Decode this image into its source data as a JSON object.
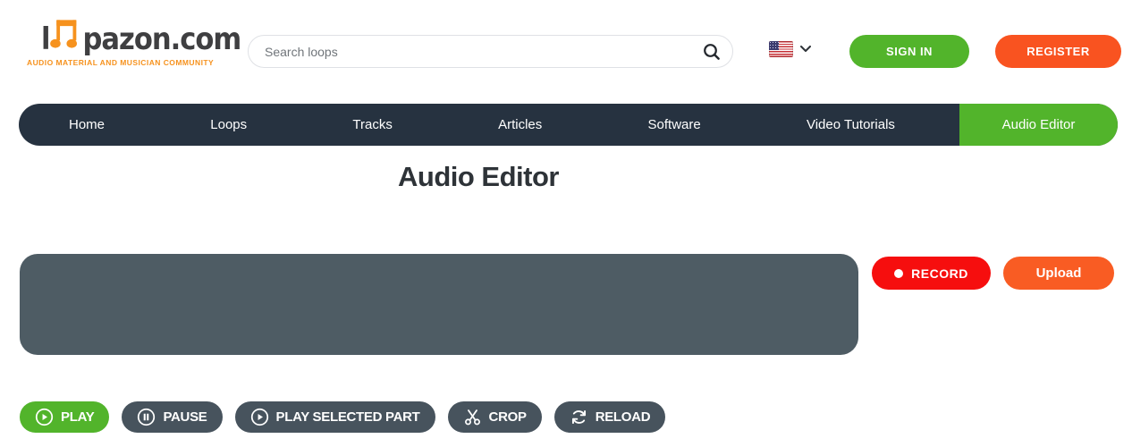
{
  "colors": {
    "accent_green": "#52B42B",
    "register_orange": "#F95320",
    "upload_orange": "#F95C23",
    "record_red": "#F60E0E",
    "nav_navy": "#263240",
    "panel_slate": "#4E5C64",
    "button_dark": "#47535D",
    "brand_orange": "#F6921E"
  },
  "header": {
    "logo": {
      "text_prefix": "l",
      "text_suffix": "pazon.com",
      "tagline": "AUDIO MATERIAL AND MUSICIAN COMMUNITY",
      "notes_icon": "music-notes-icon"
    },
    "search_placeholder": "Search loops",
    "search_icon": "search-icon",
    "language": {
      "flag_icon": "us-flag-icon",
      "chevron_icon": "chevron-down-icon"
    },
    "sign_in_label": "SIGN IN",
    "register_label": "REGISTER"
  },
  "nav": {
    "items": [
      {
        "label": "Home"
      },
      {
        "label": "Loops"
      },
      {
        "label": "Tracks"
      },
      {
        "label": "Articles"
      },
      {
        "label": "Software"
      },
      {
        "label": "Video Tutorials"
      }
    ],
    "active": {
      "label": "Audio Editor"
    }
  },
  "main": {
    "title": "Audio Editor",
    "record_label": "RECORD",
    "record_icon": "record-dot-icon",
    "upload_label": "Upload",
    "controls": [
      {
        "label": "PLAY",
        "icon": "play-circle-icon",
        "variant": "green"
      },
      {
        "label": "PAUSE",
        "icon": "pause-circle-icon",
        "variant": "dark"
      },
      {
        "label": "PLAY SELECTED PART",
        "icon": "play-circle-icon",
        "variant": "dark"
      },
      {
        "label": "CROP",
        "icon": "scissors-icon",
        "variant": "dark"
      },
      {
        "label": "RELOAD",
        "icon": "reload-icon",
        "variant": "dark"
      }
    ]
  }
}
